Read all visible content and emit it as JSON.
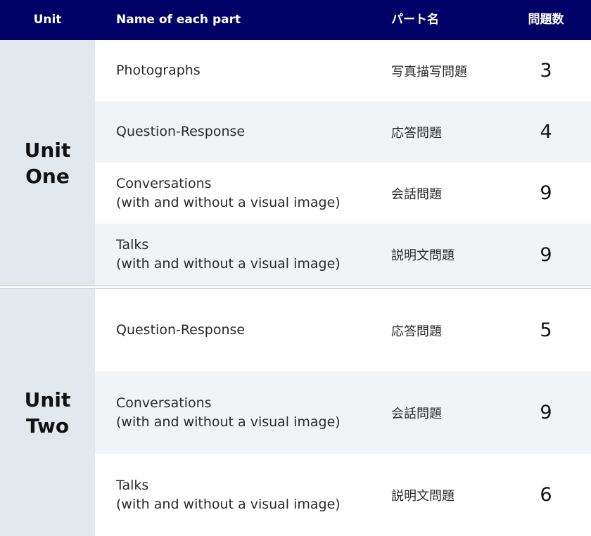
{
  "header": {
    "unit": "Unit",
    "name": "Name of each part",
    "part": "パート名",
    "count": "問題数"
  },
  "units": [
    {
      "title_line1": "Unit",
      "title_line2": "One",
      "rows": [
        {
          "name_line1": "Photographs",
          "name_line2": "",
          "part": "写真描写問題",
          "count": "3"
        },
        {
          "name_line1": "Question-Response",
          "name_line2": "",
          "part": "応答問題",
          "count": "4"
        },
        {
          "name_line1": "Conversations",
          "name_line2": "(with and without a visual image)",
          "part": "会話問題",
          "count": "9"
        },
        {
          "name_line1": "Talks",
          "name_line2": "(with and without a visual image)",
          "part": "説明文問題",
          "count": "9"
        }
      ]
    },
    {
      "title_line1": "Unit",
      "title_line2": "Two",
      "rows": [
        {
          "name_line1": "Question-Response",
          "name_line2": "",
          "part": "応答問題",
          "count": "5"
        },
        {
          "name_line1": "Conversations",
          "name_line2": "(with and without a visual image)",
          "part": "会話問題",
          "count": "9"
        },
        {
          "name_line1": "Talks",
          "name_line2": "(with and without a visual image)",
          "part": "説明文問題",
          "count": "6"
        }
      ]
    }
  ],
  "colors": {
    "header_bg": "#000066",
    "unit_cell_bg": "#e3e8ee",
    "alt_row_bg": "#f1f4f7"
  }
}
